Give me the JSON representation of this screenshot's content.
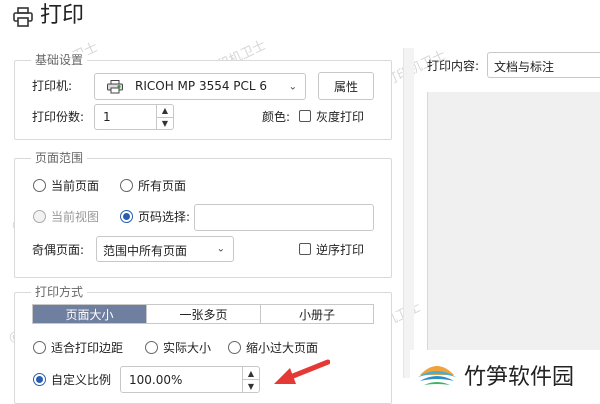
{
  "title": "打印",
  "basic": {
    "legend": "基础设置",
    "printer_label": "打印机:",
    "printer_value": "RICOH MP 3554 PCL 6",
    "properties_button": "属性",
    "copies_label": "打印份数:",
    "copies_value": "1",
    "color_label": "颜色:",
    "grayscale_label": "灰度打印"
  },
  "page_range": {
    "legend": "页面范围",
    "current_page": "当前页面",
    "all_pages": "所有页面",
    "current_view": "当前视图",
    "page_select": "页码选择:",
    "page_select_value": "",
    "odd_even_label": "奇偶页面:",
    "odd_even_value": "范围中所有页面",
    "reverse_label": "逆序打印"
  },
  "print_mode": {
    "legend": "打印方式",
    "tabs": [
      "页面大小",
      "一张多页",
      "小册子"
    ],
    "fit_margins": "适合打印边距",
    "actual_size": "实际大小",
    "shrink_large": "缩小过大页面",
    "custom_scale": "自定义比例",
    "scale_value": "100.00%"
  },
  "right": {
    "content_label": "打印内容:",
    "content_value": "文档与标注"
  },
  "watermarks": [
    "@打印机卫士",
    "@打印机卫士",
    "@打印机卫士",
    "@打印机卫士",
    "@打印机卫士",
    "@打印机卫士",
    "@打印机卫士",
    "@打印机卫士"
  ],
  "brand": "竹笋软件园",
  "colors": {
    "accent": "#2a5db0",
    "tab_active": "#6f7f9f",
    "arrow": "#e53935"
  }
}
